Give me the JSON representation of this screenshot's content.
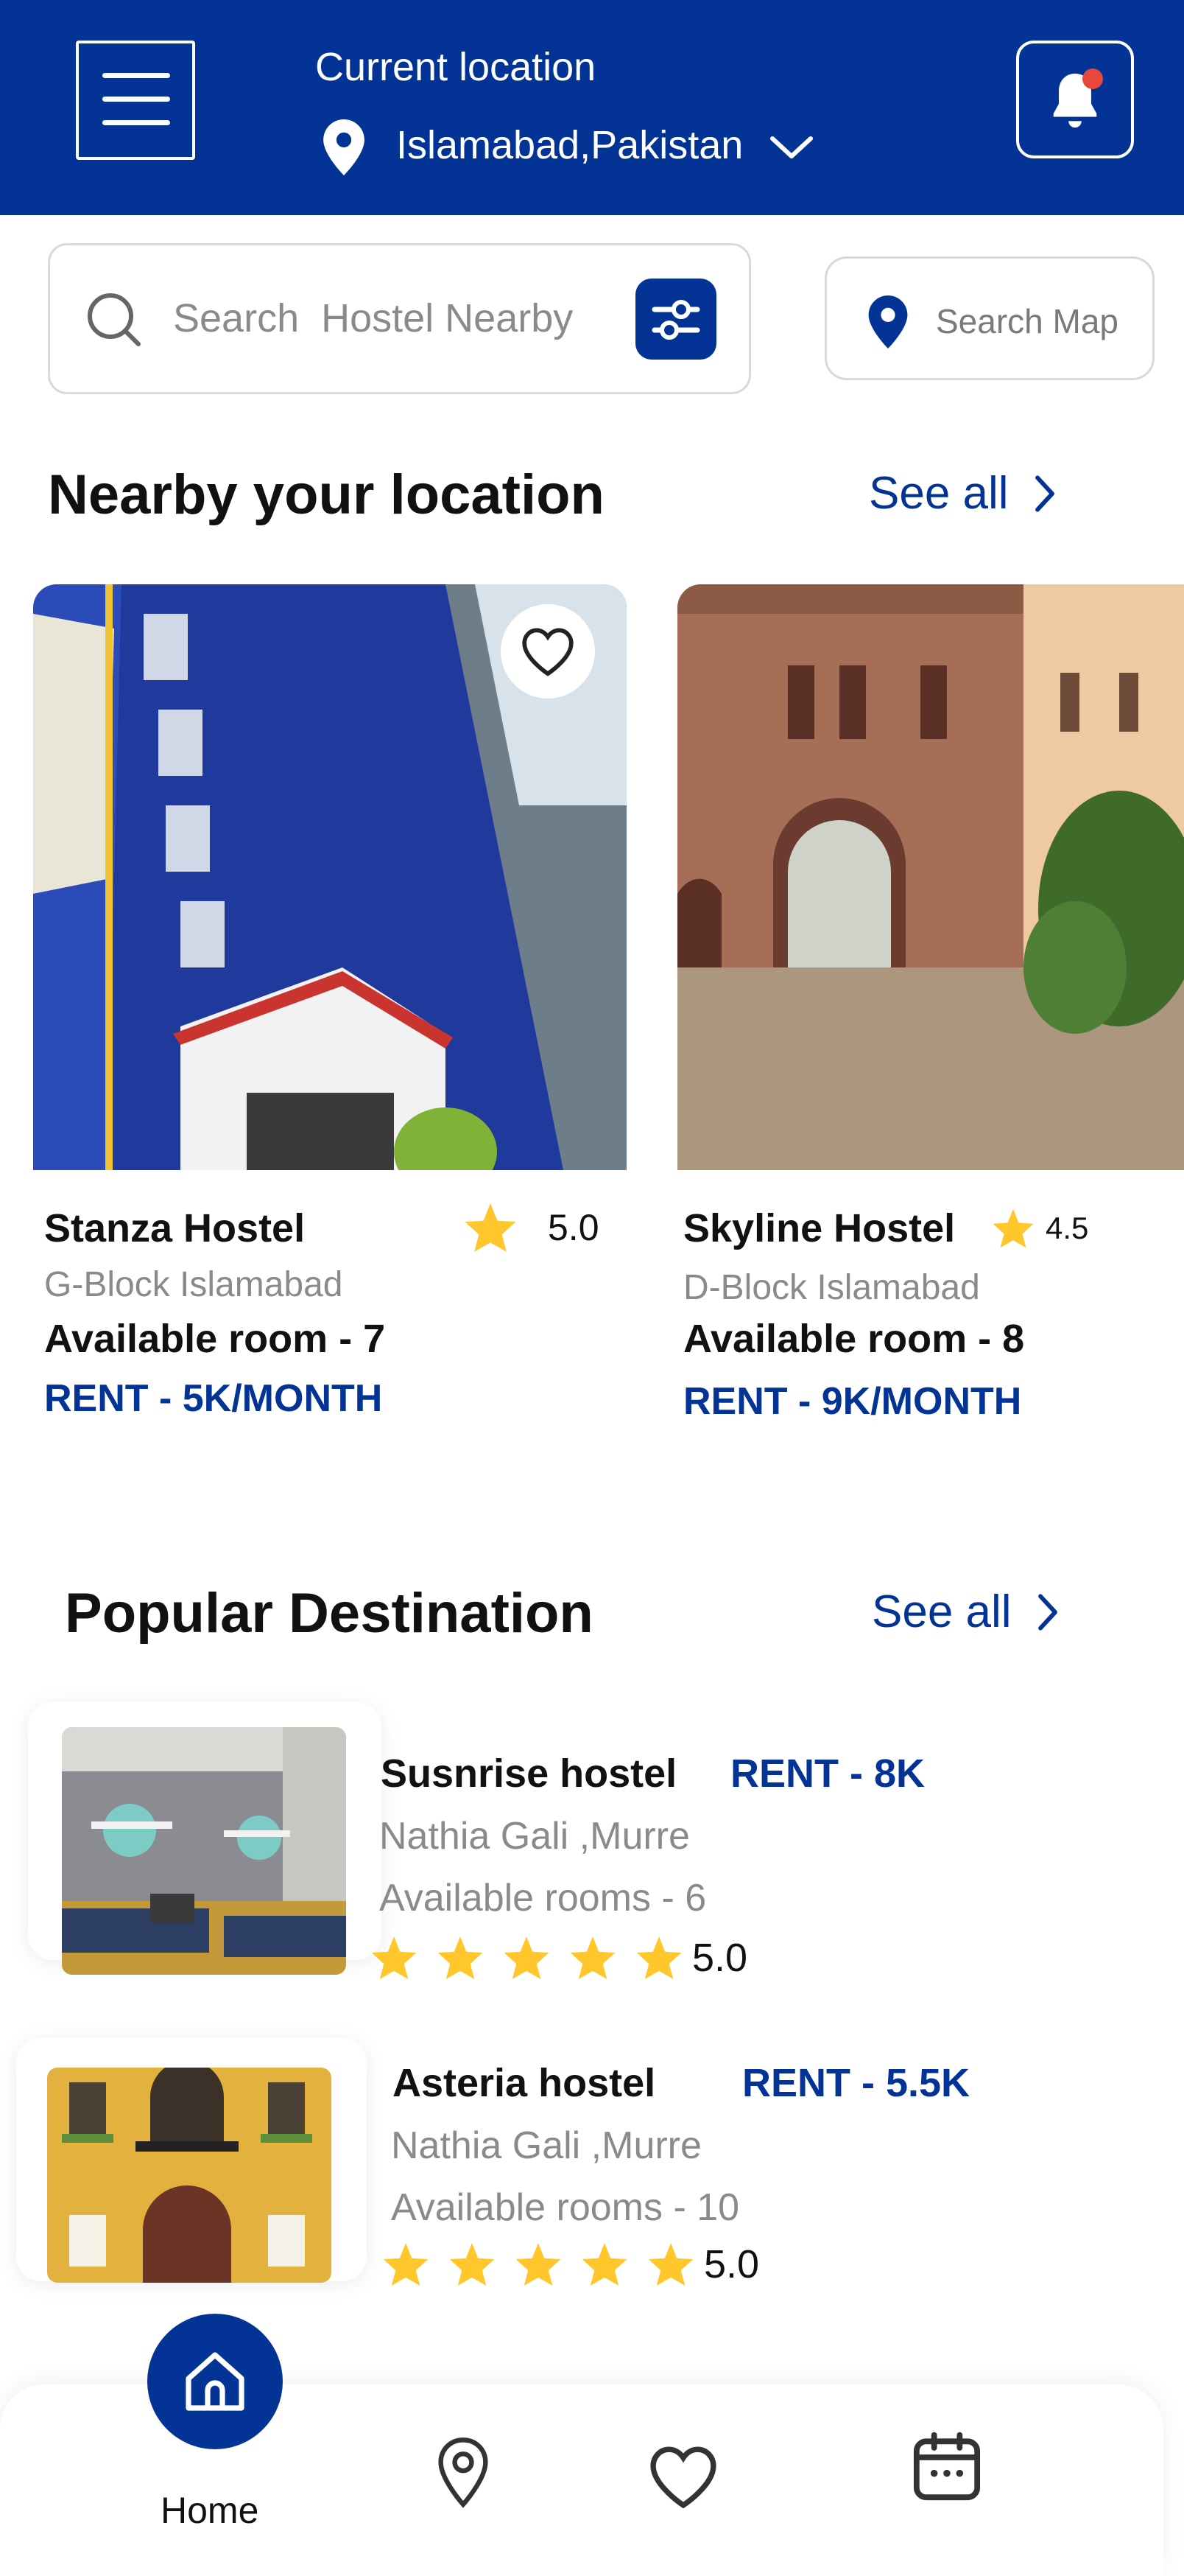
{
  "colors": {
    "primary": "#033495",
    "star": "#FFC72C",
    "notification_dot": "#E8473C"
  },
  "header": {
    "menu_icon": "hamburger-menu-icon",
    "location_label": "Current location",
    "location_value": "Islamabad,Pakistan",
    "location_icon": "location-pin-icon",
    "dropdown_icon": "chevron-down-icon",
    "bell_icon": "bell-icon"
  },
  "search": {
    "placeholder": "Search  Hostel Nearby",
    "search_icon": "search-icon",
    "filter_icon": "sliders-icon",
    "map_button_label": "Search Map"
  },
  "nearby": {
    "title": "Nearby your location",
    "see_all": "See all",
    "cards": [
      {
        "name": "Stanza Hostel",
        "rating": "5.0",
        "address": "G-Block Islamabad",
        "rooms": "Available room - 7",
        "rent": "RENT - 5K/MONTH",
        "image": "blue-hostel-building-photo"
      },
      {
        "name": "Skyline Hostel",
        "rating": "4.5",
        "address": "D-Block Islamabad",
        "rooms": "Available room - 8",
        "rent": "RENT - 9K/MONTH",
        "image": "stone-building-courtyard-photo"
      }
    ]
  },
  "popular": {
    "title": "Popular Destination",
    "see_all": "See all",
    "items": [
      {
        "name": "Susnrise hostel",
        "rent": "RENT - 8K",
        "location": "Nathia Gali ,Murre",
        "rooms": "Available rooms - 6",
        "rating": "5.0",
        "stars": 5,
        "image": "dorm-room-photo"
      },
      {
        "name": "Asteria hostel",
        "rent": "RENT - 5.5K",
        "location": "Nathia Gali ,Murre",
        "rooms": "Available rooms - 10",
        "rating": "5.0",
        "stars": 5,
        "image": "yellow-building-photo"
      }
    ]
  },
  "bottom_nav": {
    "home_label": "Home",
    "items": [
      "home-icon",
      "location-pin-icon",
      "heart-icon",
      "calendar-icon"
    ]
  }
}
